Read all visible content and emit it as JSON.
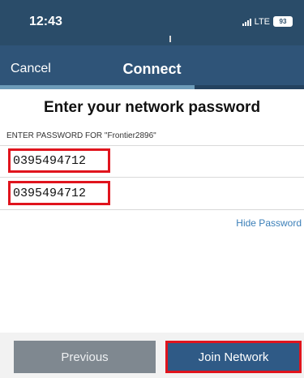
{
  "status_bar": {
    "time": "12:43",
    "network": "LTE",
    "battery": "93"
  },
  "nav": {
    "cancel_label": "Cancel",
    "title": "Connect",
    "progress_fraction": 0.64
  },
  "main": {
    "heading": "Enter your network password",
    "subheading": "ENTER PASSWORD FOR \"Frontier2896\"",
    "password_value": "0395494712",
    "confirm_value": "0395494712",
    "hide_password_label": "Hide Password"
  },
  "footer": {
    "previous_label": "Previous",
    "join_label": "Join Network"
  },
  "colors": {
    "header_bg": "#2f5478",
    "highlight": "#e0141d",
    "link": "#3b7fb8",
    "join_bg": "#2f5a86"
  }
}
